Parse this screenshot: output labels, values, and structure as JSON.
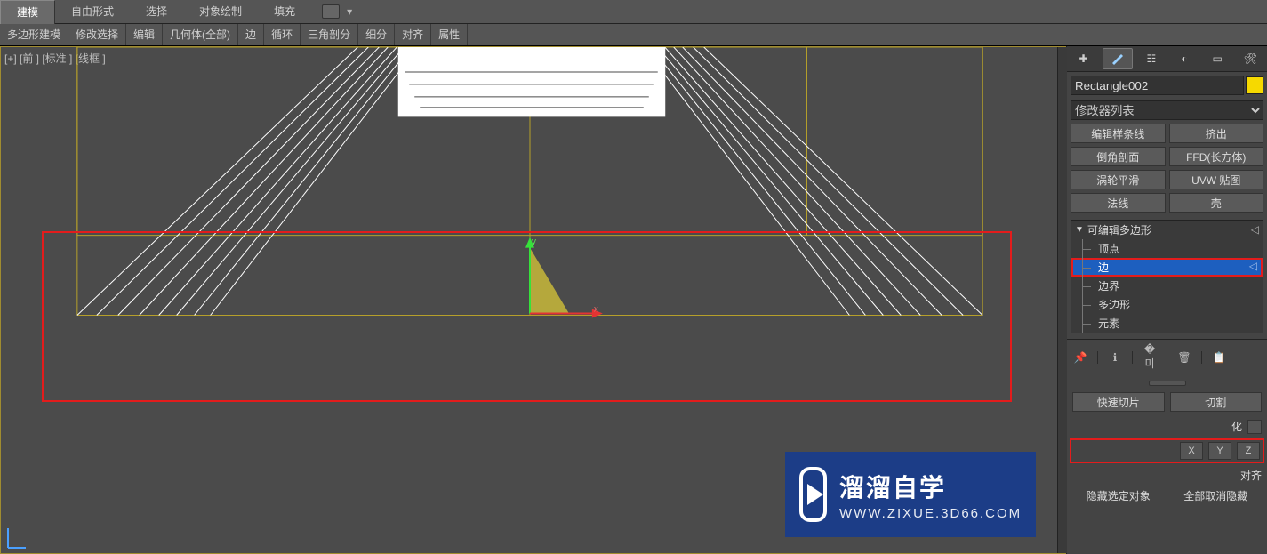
{
  "ribbon1": {
    "tabs": [
      "建模",
      "自由形式",
      "选择",
      "对象绘制",
      "填充"
    ]
  },
  "ribbon2": {
    "items": [
      "多边形建模",
      "修改选择",
      "编辑",
      "几何体(全部)",
      "边",
      "循环",
      "三角剖分",
      "细分",
      "对齐",
      "属性"
    ]
  },
  "viewport": {
    "label": "[+] [前 ] [标准 ] [线框 ]"
  },
  "panel": {
    "object_name": "Rectangle002",
    "modifier_list_label": "修改器列表",
    "quick_buttons": [
      "编辑样条线",
      "挤出",
      "倒角剖面",
      "FFD(长方体)",
      "涡轮平滑",
      "UVW 贴图",
      "法线",
      "壳"
    ],
    "stack_header": "可编辑多边形",
    "stack_items": [
      "顶点",
      "边",
      "边界",
      "多边形",
      "元素"
    ],
    "stack_selected_index": 1,
    "tools_row": [
      "快速切片",
      "切割"
    ],
    "hidden_row_a_label": "化",
    "axis_row": {
      "x": "X",
      "y": "Y",
      "z": "Z"
    },
    "align_label": "对齐",
    "bottom_labels": [
      "隐藏选定对象",
      "全部取消隐藏"
    ]
  },
  "watermark": {
    "big": "溜溜自学",
    "small": "WWW.ZIXUE.3D66.COM"
  }
}
